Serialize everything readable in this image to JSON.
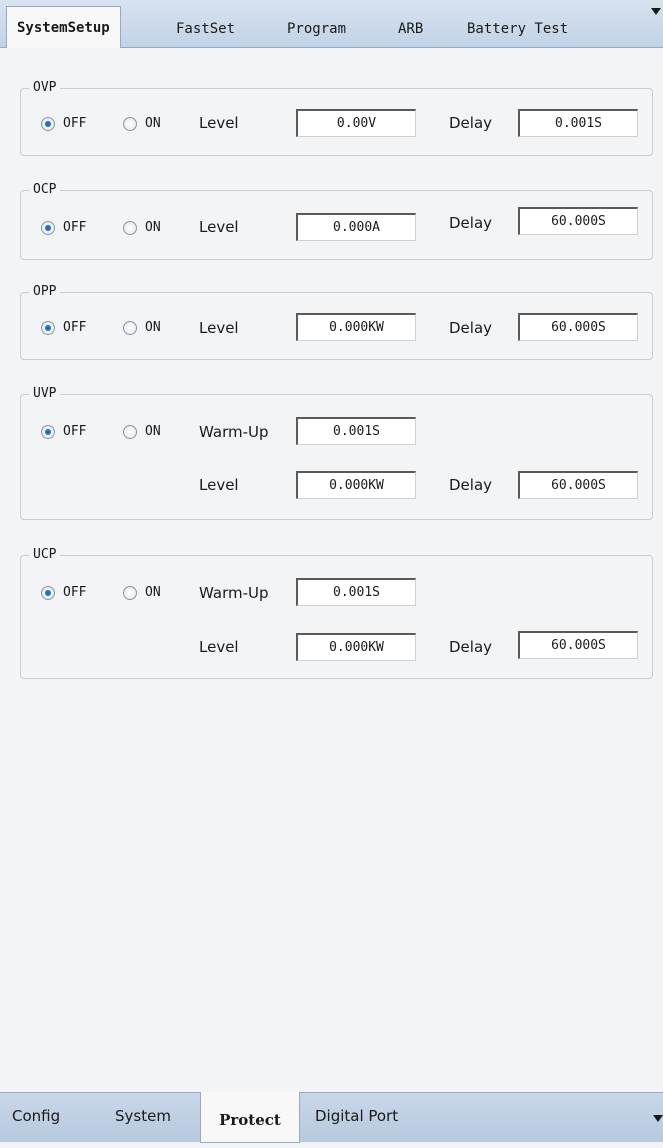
{
  "top_tabs": [
    "SystemSetup",
    "FastSet",
    "Program",
    "ARB",
    "Battery Test"
  ],
  "labels": {
    "off": "OFF",
    "on": "ON",
    "level": "Level",
    "delay": "Delay",
    "warmup": "Warm-Up"
  },
  "groups": {
    "ovp": {
      "title": "OVP",
      "selected": "OFF",
      "level": "0.00V",
      "delay": "0.001S"
    },
    "ocp": {
      "title": "OCP",
      "selected": "OFF",
      "level": "0.000A",
      "delay": "60.000S"
    },
    "opp": {
      "title": "OPP",
      "selected": "OFF",
      "level": "0.000KW",
      "delay": "60.000S"
    },
    "uvp": {
      "title": "UVP",
      "selected": "OFF",
      "warmup": "0.001S",
      "level": "0.000KW",
      "delay": "60.000S"
    },
    "ucp": {
      "title": "UCP",
      "selected": "OFF",
      "warmup": "0.001S",
      "level": "0.000KW",
      "delay": "60.000S"
    }
  },
  "bottom_tabs": [
    "Config",
    "System",
    "Protect",
    "Digital Port"
  ],
  "active_bottom_tab": "Protect",
  "active_top_tab": "SystemSetup"
}
